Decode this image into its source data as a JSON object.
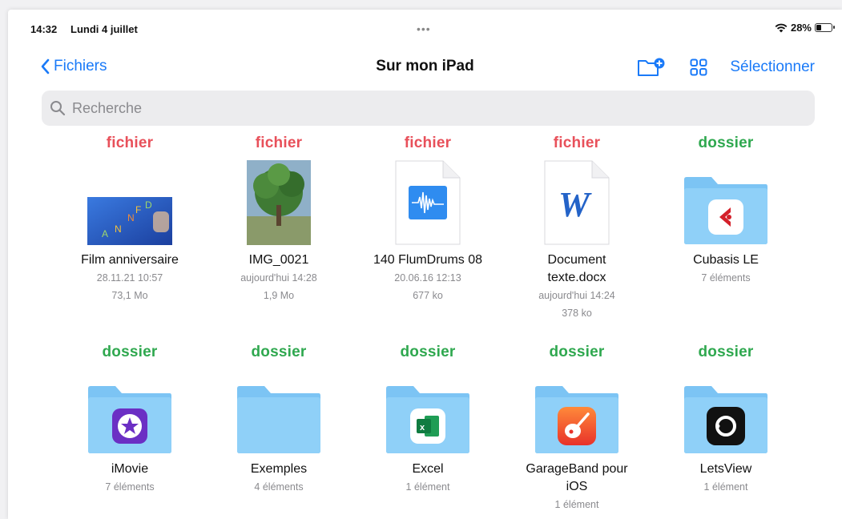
{
  "status_bar": {
    "time": "14:32",
    "date": "Lundi 4 juillet",
    "dots": "•••",
    "battery": "28%"
  },
  "nav": {
    "back_label": "Fichiers",
    "title": "Sur mon iPad",
    "select_label": "Sélectionner"
  },
  "search": {
    "placeholder": "Recherche"
  },
  "row1": [
    {
      "tag": "fichier",
      "name": "Film anniversaire",
      "meta": [
        "28.11.21 10:57",
        "73,1 Mo"
      ]
    },
    {
      "tag": "fichier",
      "name": "IMG_0021",
      "meta": [
        "aujourd'hui 14:28",
        "1,9 Mo"
      ]
    },
    {
      "tag": "fichier",
      "name": "140 FlumDrums 08",
      "meta": [
        "20.06.16 12:13",
        "677 ko"
      ]
    },
    {
      "tag": "fichier",
      "name": "Document texte.docx",
      "meta": [
        "aujourd'hui 14:24",
        "378 ko"
      ]
    },
    {
      "tag": "dossier",
      "name": "Cubasis LE",
      "meta": [
        "7 éléments"
      ]
    }
  ],
  "row2": [
    {
      "tag": "dossier",
      "name": "iMovie",
      "meta": [
        "7 éléments"
      ]
    },
    {
      "tag": "dossier",
      "name": "Exemples",
      "meta": [
        "4 éléments"
      ]
    },
    {
      "tag": "dossier",
      "name": "Excel",
      "meta": [
        "1 élément"
      ]
    },
    {
      "tag": "dossier",
      "name": "GarageBand pour iOS",
      "meta": [
        "1 élément"
      ]
    },
    {
      "tag": "dossier",
      "name": "LetsView",
      "meta": [
        "1 élément"
      ]
    }
  ],
  "video_thumb_letters": [
    "A",
    "N",
    "N",
    "F",
    "D"
  ],
  "colors": {
    "accent": "#1a7af8",
    "file_tag": "#e8505a",
    "folder_tag": "#2fa84f",
    "folder": "#7cc4f4"
  }
}
